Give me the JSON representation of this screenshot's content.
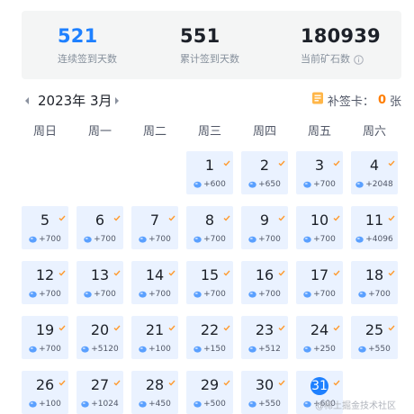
{
  "stats": [
    {
      "value": "521",
      "label": "连续签到天数",
      "highlight": true
    },
    {
      "value": "551",
      "label": "累计签到天数",
      "highlight": false
    },
    {
      "value": "180939",
      "label": "当前矿石数",
      "highlight": false,
      "info_icon": "info-icon"
    }
  ],
  "calendar": {
    "title": "2023年 3月",
    "supplement_label": "补签卡：",
    "supplement_count": "0",
    "supplement_unit": "张",
    "weekdays": [
      "周日",
      "周一",
      "周二",
      "周三",
      "周四",
      "周五",
      "周六"
    ],
    "days": [
      {
        "day": "1",
        "reward": "+600"
      },
      {
        "day": "2",
        "reward": "+650"
      },
      {
        "day": "3",
        "reward": "+700"
      },
      {
        "day": "4",
        "reward": "+2048"
      },
      {
        "day": "5",
        "reward": "+700"
      },
      {
        "day": "6",
        "reward": "+700"
      },
      {
        "day": "7",
        "reward": "+700"
      },
      {
        "day": "8",
        "reward": "+700"
      },
      {
        "day": "9",
        "reward": "+700"
      },
      {
        "day": "10",
        "reward": "+700"
      },
      {
        "day": "11",
        "reward": "+4096"
      },
      {
        "day": "12",
        "reward": "+700"
      },
      {
        "day": "13",
        "reward": "+700"
      },
      {
        "day": "14",
        "reward": "+700"
      },
      {
        "day": "15",
        "reward": "+700"
      },
      {
        "day": "16",
        "reward": "+700"
      },
      {
        "day": "17",
        "reward": "+700"
      },
      {
        "day": "18",
        "reward": "+700"
      },
      {
        "day": "19",
        "reward": "+700"
      },
      {
        "day": "20",
        "reward": "+5120"
      },
      {
        "day": "21",
        "reward": "+100"
      },
      {
        "day": "22",
        "reward": "+150"
      },
      {
        "day": "23",
        "reward": "+512"
      },
      {
        "day": "24",
        "reward": "+250"
      },
      {
        "day": "25",
        "reward": "+550"
      },
      {
        "day": "26",
        "reward": "+100"
      },
      {
        "day": "27",
        "reward": "+1024"
      },
      {
        "day": "28",
        "reward": "+450"
      },
      {
        "day": "29",
        "reward": "+500"
      },
      {
        "day": "30",
        "reward": "+550"
      },
      {
        "day": "31",
        "reward": "+600",
        "today": true
      }
    ]
  },
  "watermark": "@稀土掘金技术社区",
  "colors": {
    "accent": "#1e80ff",
    "orange": "#ff7d00",
    "cell_bg": "#eaf2ff"
  }
}
